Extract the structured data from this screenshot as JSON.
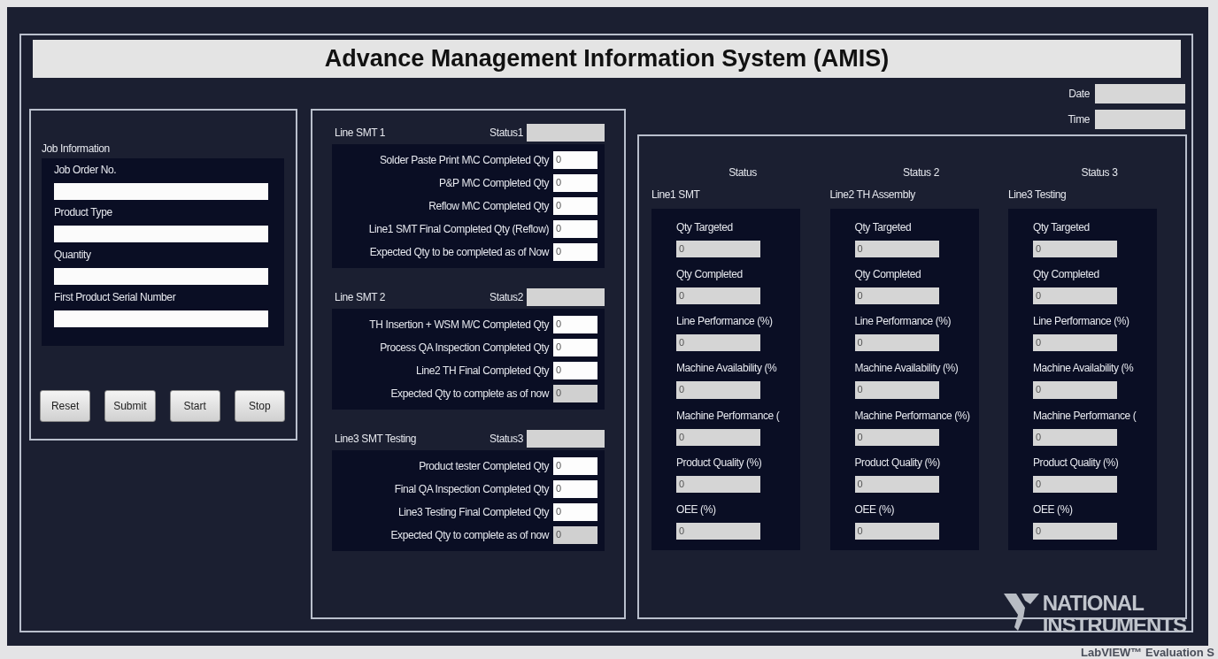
{
  "title": "Advance Management Information System (AMIS)",
  "job_information": {
    "label": "Job Information",
    "fields": [
      {
        "label": "Job Order No."
      },
      {
        "label": "Product Type"
      },
      {
        "label": "Quantity"
      },
      {
        "label": "First Product Serial Number"
      }
    ]
  },
  "buttons": [
    "Reset",
    "Submit",
    "Start",
    "Stop"
  ],
  "lines": [
    {
      "name": "Line SMT 1",
      "status_label": "Status1",
      "rows": [
        {
          "label": "Solder Paste Print M\\C Completed Qty",
          "value": "0",
          "kind": "control"
        },
        {
          "label": "P&P M\\C Completed Qty",
          "value": "0",
          "kind": "control"
        },
        {
          "label": "Reflow M\\C Completed Qty",
          "value": "0",
          "kind": "control"
        },
        {
          "label": "Line1 SMT Final Completed Qty (Reflow)",
          "value": "0",
          "kind": "control"
        },
        {
          "label": "Expected Qty to be completed as of Now",
          "value": "0",
          "kind": "control"
        }
      ]
    },
    {
      "name": "Line SMT 2",
      "status_label": "Status2",
      "rows": [
        {
          "label": "TH Insertion + WSM M/C Completed Qty",
          "value": "0",
          "kind": "control"
        },
        {
          "label": "Process QA Inspection Completed Qty",
          "value": "0",
          "kind": "control"
        },
        {
          "label": "Line2 TH  Final Completed Qty",
          "value": "0",
          "kind": "control"
        },
        {
          "label": "Expected Qty to complete as of now",
          "value": "0",
          "kind": "indicator"
        }
      ]
    },
    {
      "name": "Line3 SMT  Testing",
      "status_label": "Status3",
      "rows": [
        {
          "label": "Product tester  Completed Qty",
          "value": "0",
          "kind": "control"
        },
        {
          "label": "Final QA Inspection Completed Qty",
          "value": "0",
          "kind": "control"
        },
        {
          "label": "Line3 Testing Final Completed Qty",
          "value": "0",
          "kind": "control"
        },
        {
          "label": "Expected Qty to complete as of now",
          "value": "0",
          "kind": "indicator"
        }
      ]
    }
  ],
  "datetime": [
    {
      "label": "Date"
    },
    {
      "label": "Time"
    }
  ],
  "summary": [
    {
      "status_label": "Status",
      "name": "Line1 SMT",
      "metrics": [
        {
          "label": "Qty Targeted",
          "value": "0"
        },
        {
          "label": "Qty Completed",
          "value": "0"
        },
        {
          "label": "Line Performance (%)",
          "value": "0"
        },
        {
          "label": "Machine Availability (%",
          "value": "0"
        },
        {
          "label": "Machine Performance (",
          "value": "0"
        },
        {
          "label": "Product Quality (%)",
          "value": "0"
        },
        {
          "label": "OEE (%)",
          "value": "0"
        }
      ]
    },
    {
      "status_label": "Status 2",
      "name": "Line2 TH Assembly",
      "metrics": [
        {
          "label": "Qty Targeted",
          "value": "0"
        },
        {
          "label": "Qty Completed",
          "value": "0"
        },
        {
          "label": "Line Performance (%)",
          "value": "0"
        },
        {
          "label": "Machine Availability (%)",
          "value": "0"
        },
        {
          "label": "Machine Performance (%)",
          "value": "0"
        },
        {
          "label": "Product Quality (%)",
          "value": "0"
        },
        {
          "label": "OEE (%)",
          "value": "0"
        }
      ]
    },
    {
      "status_label": "Status 3",
      "name": "Line3 Testing",
      "metrics": [
        {
          "label": "Qty Targeted",
          "value": "0"
        },
        {
          "label": "Qty Completed",
          "value": "0"
        },
        {
          "label": "Line Performance (%)",
          "value": "0"
        },
        {
          "label": "Machine Availability (%",
          "value": "0"
        },
        {
          "label": "Machine Performance (",
          "value": "0"
        },
        {
          "label": "Product Quality (%)",
          "value": "0"
        },
        {
          "label": "OEE (%)",
          "value": "0"
        }
      ]
    }
  ],
  "evaluation_badge": {
    "brand_lines": [
      "NATIONAL",
      "INSTRUMENTS"
    ],
    "caption": "LabVIEW™ Evaluation S"
  }
}
